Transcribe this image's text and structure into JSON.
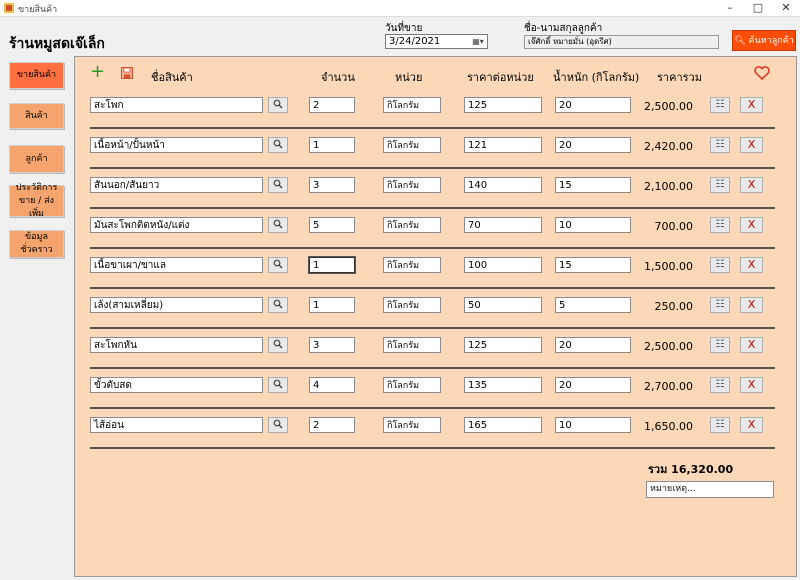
{
  "window": {
    "title": "ขายสินค้า",
    "minimize": "–",
    "maximize": "□",
    "close": "✕"
  },
  "store_name": "ร้านหมูสดเจ๊เล็ก",
  "sale_date": {
    "label": "วันที่ขาย",
    "value": "3/24/2021"
  },
  "customer": {
    "label": "ชื่อ-นามสกุลลูกค้า",
    "value": "เจ๊ศักดิ์ หมายมั่น (อุดรีศ)"
  },
  "search_customer_button": "ค้นหาลูกค้า",
  "sidebar": [
    {
      "label": "ขายสินค้า",
      "active": true
    },
    {
      "label": "สินค้า",
      "active": false
    },
    {
      "label": "ลูกค้า",
      "active": false
    },
    {
      "label": "ประวัติการขาย / ส่งเพิ่ม",
      "active": false
    },
    {
      "label": "ข้อมูลชั่วคราว",
      "active": false
    }
  ],
  "columns": {
    "product": "ชื่อสินค้า",
    "quantity": "จำนวน",
    "unit": "หน่วย",
    "unit_price": "ราคาต่อหน่วย",
    "weight": "น้ำหนัก (กิโลกรัม)",
    "total": "ราคารวม"
  },
  "rows": [
    {
      "product": "สะโพก",
      "quantity": "2",
      "unit": "กิโลกรัม",
      "price": "125",
      "weight": "20",
      "total": "2,500.00"
    },
    {
      "product": "เนื้อหน้า/ปั้นหน้า",
      "quantity": "1",
      "unit": "กิโลกรัม",
      "price": "121",
      "weight": "20",
      "total": "2,420.00"
    },
    {
      "product": "สันนอก/สันยาว",
      "quantity": "3",
      "unit": "กิโลกรัม",
      "price": "140",
      "weight": "15",
      "total": "2,100.00"
    },
    {
      "product": "มันสะโพกติดหนัง/แต่ง",
      "quantity": "5",
      "unit": "กิโลกรัม",
      "price": "70",
      "weight": "10",
      "total": "700.00"
    },
    {
      "product": "เนื้อขาเผา/ขาแล",
      "quantity": "1",
      "unit": "กิโลกรัม",
      "price": "100",
      "weight": "15",
      "total": "1,500.00"
    },
    {
      "product": "เล้ง(สามเหลี่ยม)",
      "quantity": "1",
      "unit": "กิโลกรัม",
      "price": "50",
      "weight": "5",
      "total": "250.00"
    },
    {
      "product": "สะโพกหัน",
      "quantity": "3",
      "unit": "กิโลกรัม",
      "price": "125",
      "weight": "20",
      "total": "2,500.00"
    },
    {
      "product": "ขั้วตับสด",
      "quantity": "4",
      "unit": "กิโลกรัม",
      "price": "135",
      "weight": "20",
      "total": "2,700.00"
    },
    {
      "product": "ไส้อ่อน",
      "quantity": "2",
      "unit": "กิโลกรัม",
      "price": "165",
      "weight": "10",
      "total": "1,650.00"
    }
  ],
  "delete_label": "X",
  "grand_total": "รวม 16,320.00",
  "note_placeholder": "หมายเหตุ...",
  "icons": {
    "add": "plus-icon",
    "save": "save-icon",
    "favorite": "heart-icon",
    "search": "magnifier-icon",
    "calendar": "calendar-icon",
    "edit": "edit-icon"
  },
  "colors": {
    "panel_bg": "#fcd8b8",
    "sidebar_button": "#f4a46c",
    "sidebar_active": "#ff7040",
    "search_button": "#ff4d06",
    "delete_x": "#c00000",
    "add_green": "#2c9c2c",
    "heart": "#e0301e"
  }
}
